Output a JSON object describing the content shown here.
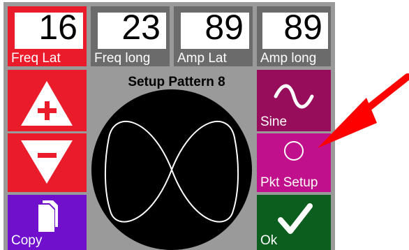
{
  "fields": [
    {
      "value": "16",
      "label": "Freq Lat",
      "selected": true
    },
    {
      "value": "23",
      "label": "Freq long",
      "selected": false
    },
    {
      "value": "89",
      "label": "Amp Lat",
      "selected": false
    },
    {
      "value": "89",
      "label": "Amp long",
      "selected": false
    }
  ],
  "pattern_title": "Setup Pattern 8",
  "buttons": {
    "increase_icon": "plus-triangle-up-icon",
    "decrease_icon": "minus-triangle-down-icon",
    "copy_label": "Copy",
    "sine_label": "Sine",
    "pkt_setup_label": "Pkt Setup",
    "ok_label": "Ok"
  },
  "colors": {
    "red": "#ea1c2c",
    "magenta_dark": "#980c5c",
    "magenta": "#c0108c",
    "purple": "#7010cc",
    "green": "#0b5e1e",
    "annotation_arrow": "#ff0000"
  }
}
